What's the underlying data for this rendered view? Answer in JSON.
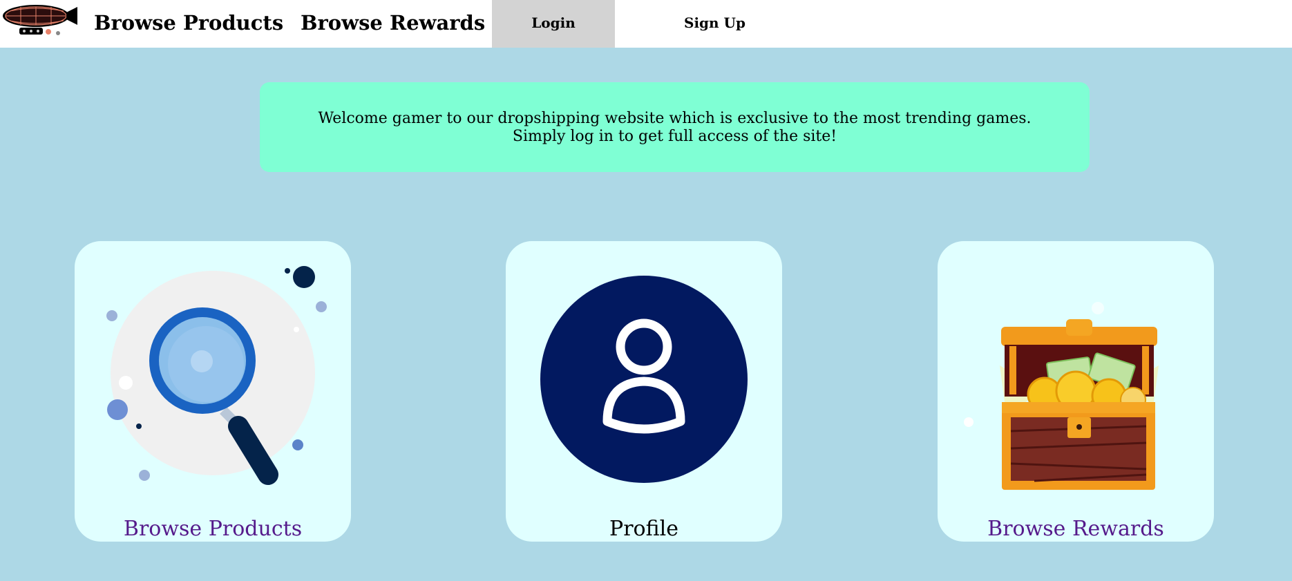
{
  "navbar": {
    "logo_icon": "airship-icon",
    "browse_products": "Browse Products",
    "browse_rewards": "Browse Rewards",
    "login": "Login",
    "sign_up": "Sign Up"
  },
  "welcome": {
    "line1": "Welcome gamer to our dropshipping website which is exclusive to the most trending games.",
    "line2": "Simply log in to get full access of the site!"
  },
  "cards": [
    {
      "label": "Browse Products",
      "icon": "magnifying-glass-icon"
    },
    {
      "label": "Profile",
      "icon": "user-profile-icon"
    },
    {
      "label": "Browse Rewards",
      "icon": "treasure-chest-icon"
    }
  ],
  "colors": {
    "background": "#add8e6",
    "navbar": "#ffffff",
    "active_nav": "#d3d3d3",
    "welcome_box": "#7fffd4",
    "card": "#e0ffff",
    "visited_link": "#551a8b",
    "profile_circle": "#021960"
  }
}
